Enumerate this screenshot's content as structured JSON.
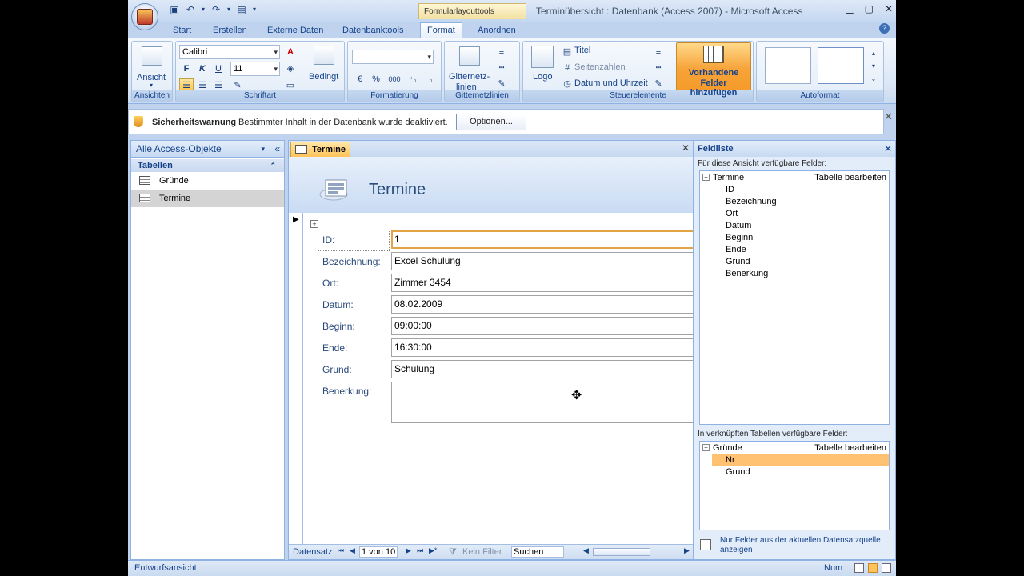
{
  "window": {
    "title": "Terminübersicht : Datenbank (Access 2007) - Microsoft Access",
    "context_tab_title": "Formularlayouttools"
  },
  "tabs": [
    "Start",
    "Erstellen",
    "Externe Daten",
    "Datenbanktools",
    "Format",
    "Anordnen"
  ],
  "active_tab": "Format",
  "ribbon": {
    "ansicht": {
      "button": "Ansicht",
      "label": "Ansichten"
    },
    "schriftart": {
      "font": "Calibri",
      "size": "11",
      "bold": "F",
      "italic": "K",
      "underline": "U",
      "bedingt": "Bedingt",
      "label": "Schriftart"
    },
    "formatierung": {
      "percent": "%",
      "thousands": "000",
      "label": "Formatierung"
    },
    "gitternetz": {
      "button_line1": "Gitternetz-",
      "button_line2": "linien",
      "label": "Gitternetzlinien"
    },
    "steuerelemente": {
      "logo": "Logo",
      "titel": "Titel",
      "seitenzahlen": "Seitenzahlen",
      "datum": "Datum und Uhrzeit",
      "label": "Steuerelemente"
    },
    "vorhanden": {
      "line1": "Vorhandene",
      "line2": "Felder hinzufügen"
    },
    "autoformat": {
      "label": "Autoformat"
    }
  },
  "security": {
    "title": "Sicherheitswarnung",
    "message": "Bestimmter Inhalt in der Datenbank wurde deaktiviert.",
    "button": "Optionen..."
  },
  "nav": {
    "header": "Alle Access-Objekte",
    "group": "Tabellen",
    "items": [
      {
        "label": "Gründe",
        "selected": false
      },
      {
        "label": "Termine",
        "selected": true
      }
    ]
  },
  "doc": {
    "tab": "Termine",
    "title": "Termine",
    "fields": [
      {
        "label": "ID:",
        "value": "1"
      },
      {
        "label": "Bezeichnung:",
        "value": "Excel Schulung"
      },
      {
        "label": "Ort:",
        "value": "Zimmer 3454"
      },
      {
        "label": "Datum:",
        "value": "08.02.2009"
      },
      {
        "label": "Beginn:",
        "value": "09:00:00"
      },
      {
        "label": "Ende:",
        "value": "16:30:00"
      },
      {
        "label": "Grund:",
        "value": "Schulung"
      },
      {
        "label": "Benerkung:",
        "value": ""
      }
    ],
    "recordnav": {
      "label": "Datensatz:",
      "position": "1 von 10",
      "filter": "Kein Filter",
      "search": "Suchen"
    }
  },
  "fieldlist": {
    "title": "Feldliste",
    "available_label": "Für diese Ansicht verfügbare Felder:",
    "table1": "Termine",
    "edit_table": "Tabelle bearbeiten",
    "fields1": [
      "ID",
      "Bezeichnung",
      "Ort",
      "Datum",
      "Beginn",
      "Ende",
      "Grund",
      "Benerkung"
    ],
    "related_label": "In verknüpften Tabellen verfügbare Felder:",
    "table2": "Gründe",
    "fields2": [
      {
        "label": "Nr",
        "selected": true
      },
      {
        "label": "Grund",
        "selected": false
      }
    ],
    "footer_line1": "Nur Felder aus der aktuellen Datensatzquelle",
    "footer_line2": "anzeigen"
  },
  "status": {
    "left": "Entwurfsansicht",
    "num": "Num"
  },
  "colors": {
    "accent": "#f7a43a",
    "frame": "#bfd3ee",
    "selection": "#ffc273"
  }
}
